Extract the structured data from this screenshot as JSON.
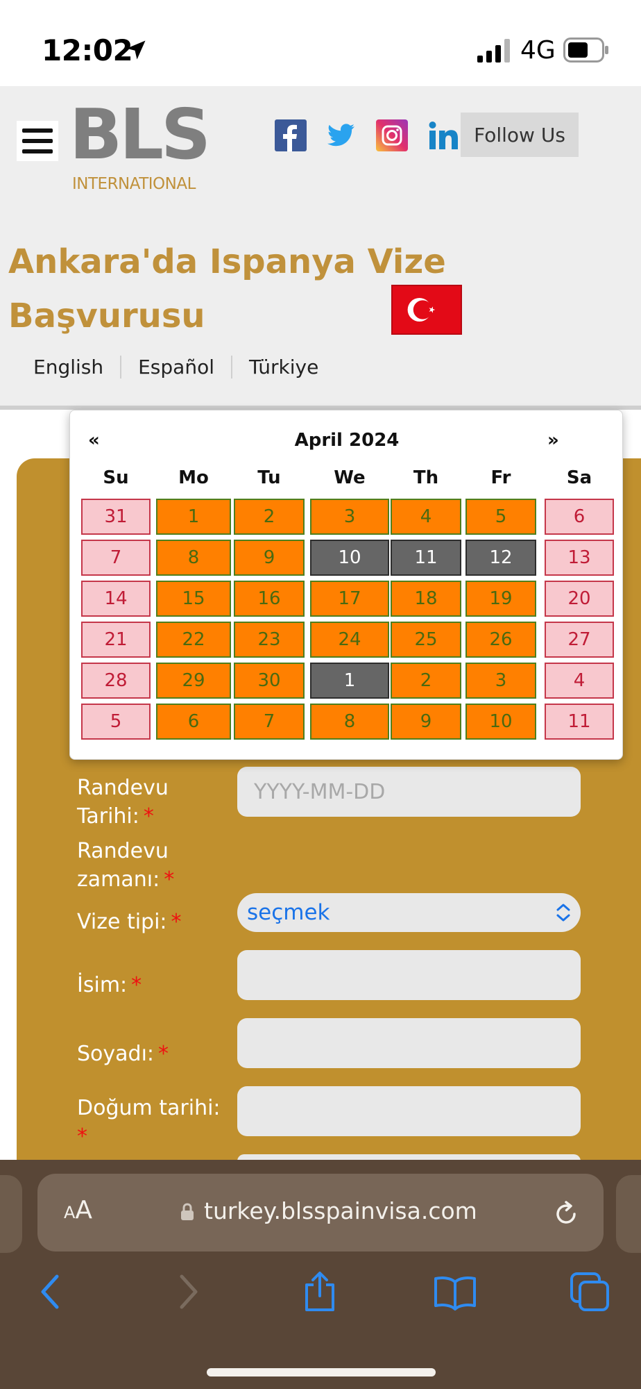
{
  "status_bar": {
    "time": "12:02",
    "network": "4G",
    "icons": [
      "location-arrow-icon",
      "signal-icon",
      "battery-icon"
    ]
  },
  "header": {
    "logo_main": "BLS",
    "logo_sub": "INTERNATIONAL",
    "social": [
      "facebook-icon",
      "twitter-icon",
      "instagram-icon",
      "linkedin-icon"
    ],
    "follow_label": "Follow Us",
    "title": "Ankara'da Ispanya Vize Başvurusu",
    "languages": [
      "English",
      "Español",
      "Türkiye"
    ]
  },
  "datepicker": {
    "prev": "«",
    "next": "»",
    "title": "April 2024",
    "weekdays": [
      "Su",
      "Mo",
      "Tu",
      "We",
      "Th",
      "Fr",
      "Sa"
    ],
    "weeks": [
      [
        [
          "31",
          "weekend"
        ],
        [
          "1",
          "avail"
        ],
        [
          "2",
          "avail"
        ],
        [
          "3",
          "avail"
        ],
        [
          "4",
          "avail"
        ],
        [
          "5",
          "avail"
        ],
        [
          "6",
          "weekend"
        ]
      ],
      [
        [
          "7",
          "weekend"
        ],
        [
          "8",
          "avail"
        ],
        [
          "9",
          "avail"
        ],
        [
          "10",
          "disabled"
        ],
        [
          "11",
          "disabled"
        ],
        [
          "12",
          "disabled"
        ],
        [
          "13",
          "weekend"
        ]
      ],
      [
        [
          "14",
          "weekend"
        ],
        [
          "15",
          "avail"
        ],
        [
          "16",
          "avail"
        ],
        [
          "17",
          "avail"
        ],
        [
          "18",
          "avail"
        ],
        [
          "19",
          "avail"
        ],
        [
          "20",
          "weekend"
        ]
      ],
      [
        [
          "21",
          "weekend"
        ],
        [
          "22",
          "avail"
        ],
        [
          "23",
          "avail"
        ],
        [
          "24",
          "avail"
        ],
        [
          "25",
          "avail"
        ],
        [
          "26",
          "avail"
        ],
        [
          "27",
          "weekend"
        ]
      ],
      [
        [
          "28",
          "weekend"
        ],
        [
          "29",
          "avail"
        ],
        [
          "30",
          "avail"
        ],
        [
          "1",
          "disabled"
        ],
        [
          "2",
          "avail"
        ],
        [
          "3",
          "avail"
        ],
        [
          "4",
          "weekend"
        ]
      ],
      [
        [
          "5",
          "weekend"
        ],
        [
          "6",
          "avail"
        ],
        [
          "7",
          "avail"
        ],
        [
          "8",
          "avail"
        ],
        [
          "9",
          "avail"
        ],
        [
          "10",
          "avail"
        ],
        [
          "11",
          "weekend"
        ]
      ]
    ]
  },
  "form": {
    "appointment_date_label_1": "Randevu",
    "appointment_date_label_2": "Tarihi:",
    "appointment_date_placeholder": "YYYY-MM-DD",
    "appointment_time_label_1": "Randevu",
    "appointment_time_label_2": "zamanı:",
    "visa_type_label": "Vize tipi:",
    "visa_type_value": "seçmek",
    "first_name_label": "İsim:",
    "last_name_label": "Soyadı:",
    "birth_date_label": "Doğum tarihi:",
    "required_mark": "*"
  },
  "browser": {
    "text_size_small": "A",
    "text_size_big": "A",
    "url": "turkey.blsspainvisa.com"
  },
  "colors": {
    "brand_gold": "#c0913b",
    "available_day": "#ff8000",
    "weekend_day": "#f8c8ce",
    "disabled_day": "#666666",
    "link_blue": "#1a73e8"
  }
}
